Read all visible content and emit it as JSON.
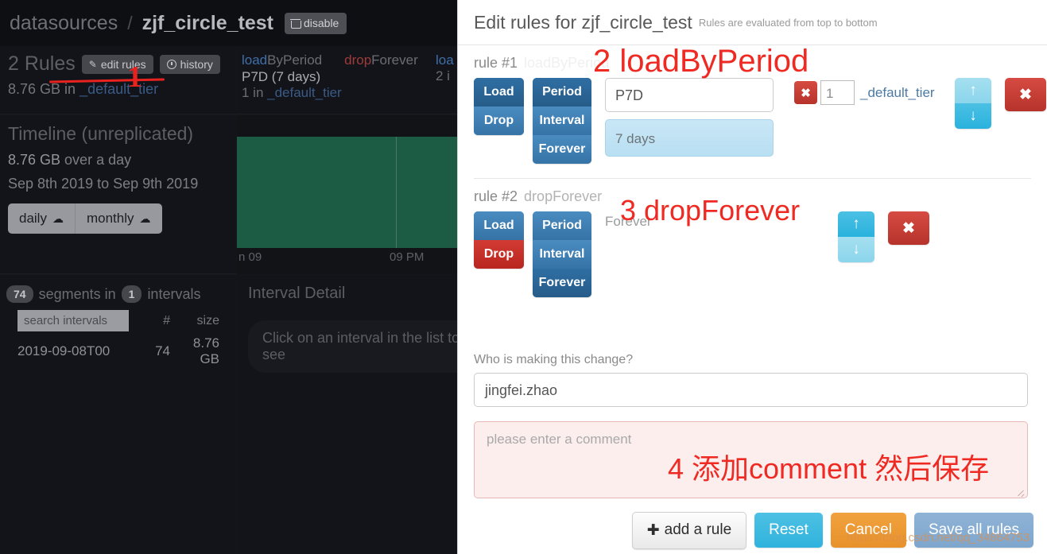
{
  "background": {
    "breadcrumb": {
      "root": "datasources",
      "separator": "/",
      "datasource": "zjf_circle_test",
      "disable_label": "disable"
    },
    "rules_panel": {
      "title": "2 Rules",
      "edit_rules_label": "edit rules",
      "history_label": "history",
      "size": "8.76 GB",
      "in_word": " in ",
      "tier": "_default_tier"
    },
    "rules_strip": {
      "rule1_prefix": "load",
      "rule1_suffix": "ByPeriod",
      "rule1_period": "P7D (7 days)",
      "rule1_count": "1 in ",
      "rule1_tier": "_default_tier",
      "rule2_prefix": "drop",
      "rule2_suffix": "Forever",
      "rule3_prefix": "loa",
      "rule3_count": "2 i"
    },
    "timeline": {
      "title": "Timeline (unreplicated)",
      "size": "8.76 GB",
      "over": " over a day",
      "range": "Sep 8th 2019 to Sep 9th 2019",
      "daily_label": "daily",
      "monthly_label": "monthly"
    },
    "chart": {
      "axis_left": "n 09",
      "axis_right": "09 PM"
    },
    "segments": {
      "count_badge": "74",
      "mid_text": "segments in",
      "intervals_badge": "1",
      "intervals_text": "intervals",
      "search_placeholder": "search intervals",
      "col_num": "#",
      "col_size": "size",
      "row_date": "2019-09-08T00",
      "row_num": "74",
      "row_size": "8.76 GB"
    },
    "interval_detail": {
      "title": "Interval Detail",
      "hint": "Click on an interval in the list to see"
    }
  },
  "modal": {
    "header": {
      "title": "Edit rules for zjf_circle_test",
      "subtitle": "Rules are evaluated from top to bottom"
    },
    "rules": [
      {
        "label": "rule #1",
        "ghost_label": "loadByPeriod",
        "load_label": "Load",
        "drop_label": "Drop",
        "period_label": "Period",
        "interval_label": "Interval",
        "forever_label": "Forever",
        "period_value": "P7D",
        "period_human": "7 days",
        "tier_remove_label": "✖",
        "tier_replicants": "1",
        "tier_name": "_default_tier",
        "up_label": "↑",
        "down_label": "↓",
        "delete_label": "✖"
      },
      {
        "label": "rule #2",
        "ghost_label": "dropForever",
        "load_label": "Load",
        "drop_label": "Drop",
        "period_label": "Period",
        "interval_label": "Interval",
        "forever_label": "Forever",
        "forever_text": "Forever",
        "up_label": "↑",
        "down_label": "↓",
        "delete_label": "✖"
      }
    ],
    "form": {
      "who_label": "Who is making this change?",
      "who_value": "jingfei.zhao",
      "comment_placeholder": "please enter a comment"
    },
    "footer": {
      "add_rule_label": "add a rule",
      "add_rule_icon": "✚",
      "reset_label": "Reset",
      "cancel_label": "Cancel",
      "save_label": "Save all rules"
    }
  },
  "annotations": {
    "one": "1",
    "two": "2 loadByPeriod",
    "three": "3 dropForever",
    "four": "4 添加comment  然后保存",
    "watermark": "https://blog.csdn.net/qq_34864753"
  },
  "colors": {
    "accent_blue": "#3b79ad",
    "danger_red": "#b6332b",
    "cyan": "#29b2dd",
    "orange": "#e8912a",
    "annotation_red": "#ee2a23",
    "chart_green": "#1d5c44"
  }
}
